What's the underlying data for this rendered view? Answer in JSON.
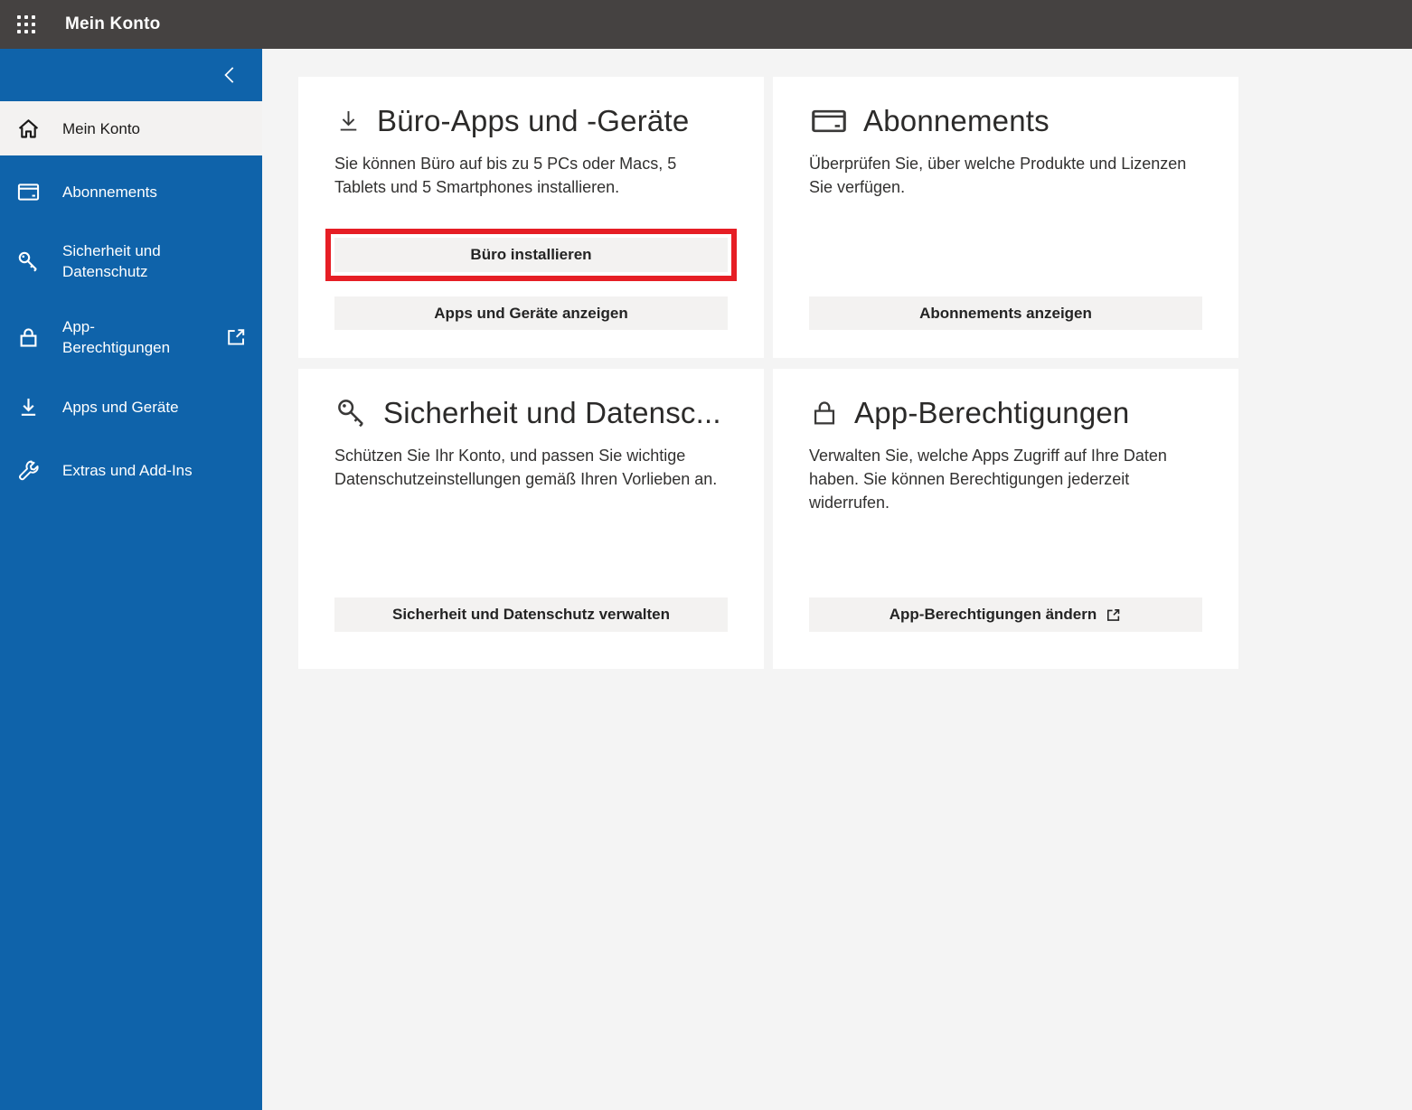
{
  "topbar": {
    "title": "Mein Konto",
    "waffle_icon": "app-launcher"
  },
  "sidebar": {
    "collapse_icon": "chevron-left",
    "items": [
      {
        "label": "Mein Konto",
        "icon": "home",
        "active": true
      },
      {
        "label": "Abonnements",
        "icon": "credit-card",
        "active": false
      },
      {
        "label": "Sicherheit und Datenschutz",
        "icon": "key",
        "active": false
      },
      {
        "label": "App-Berechtigungen",
        "icon": "lock",
        "external": true,
        "active": false
      },
      {
        "label": "Apps und Geräte",
        "icon": "download",
        "active": false
      },
      {
        "label": "Extras und Add-Ins",
        "icon": "wrench",
        "active": false
      }
    ]
  },
  "cards": [
    {
      "icon": "download",
      "title": "Büro-Apps und -Geräte",
      "description": "Sie können Büro auf bis zu 5 PCs oder Macs, 5 Tablets und 5 Smartphones installieren.",
      "buttons": [
        {
          "label": "Büro installieren",
          "highlighted": true
        },
        {
          "label": "Apps und Geräte anzeigen",
          "highlighted": false
        }
      ]
    },
    {
      "icon": "credit-card",
      "title": "Abonnements",
      "description": "Überprüfen Sie, über welche Produkte und Lizenzen Sie verfügen.",
      "buttons": [
        {
          "label": "Abonnements anzeigen",
          "highlighted": false
        }
      ]
    },
    {
      "icon": "key",
      "title": "Sicherheit und Datensc...",
      "description": "Schützen Sie Ihr Konto, und passen Sie wichtige Datenschutzeinstellungen gemäß Ihren Vorlieben an.",
      "buttons": [
        {
          "label": "Sicherheit und Datenschutz verwalten",
          "highlighted": false
        }
      ]
    },
    {
      "icon": "lock",
      "title": "App-Berechtigungen",
      "description": "Verwalten Sie, welche Apps Zugriff auf Ihre Daten haben. Sie können Berechtigungen jederzeit widerrufen.",
      "buttons": [
        {
          "label": "App-Berechtigungen ändern",
          "highlighted": false,
          "external": true
        }
      ]
    }
  ],
  "annotation": {
    "type": "highlight-box",
    "color": "#e61e25",
    "target": "Büro installieren"
  },
  "colors": {
    "topbar_bg": "#454241",
    "sidebar_bg": "#0f63aa",
    "active_item_bg": "#f3f2f1",
    "content_bg": "#f4f4f4",
    "card_bg": "#ffffff",
    "button_bg": "#f3f2f1",
    "highlight_red": "#e61e25"
  }
}
